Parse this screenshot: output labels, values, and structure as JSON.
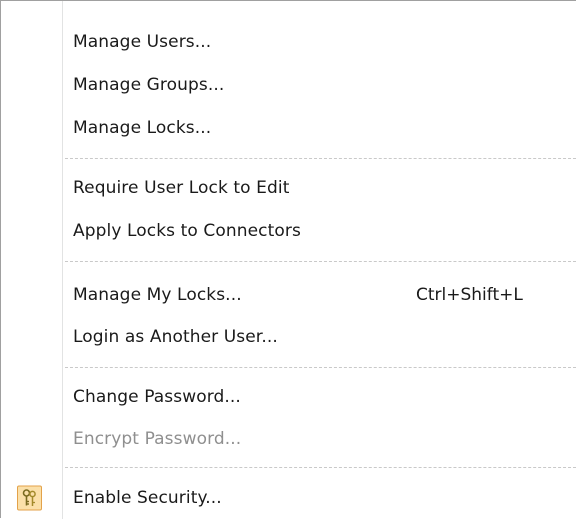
{
  "menu": {
    "items": [
      {
        "label": "Manage Users..."
      },
      {
        "label": "Manage Groups..."
      },
      {
        "label": "Manage Locks..."
      },
      {
        "label": "Require User Lock to Edit"
      },
      {
        "label": "Apply Locks to Connectors"
      },
      {
        "label": "Manage My Locks...",
        "shortcut": "Ctrl+Shift+L"
      },
      {
        "label": "Login as Another User..."
      },
      {
        "label": "Change Password..."
      },
      {
        "label": "Encrypt Password...",
        "disabled": true
      },
      {
        "label": "Enable Security...",
        "icon": "keys-icon",
        "highlighted_icon": true
      }
    ]
  },
  "colors": {
    "text": "#1a1a1a",
    "disabled_text": "#8f8f8f",
    "separator": "#c9c9c9",
    "icon_highlight_bg": "#fbe0a9",
    "icon_highlight_border": "#e3a24a"
  }
}
